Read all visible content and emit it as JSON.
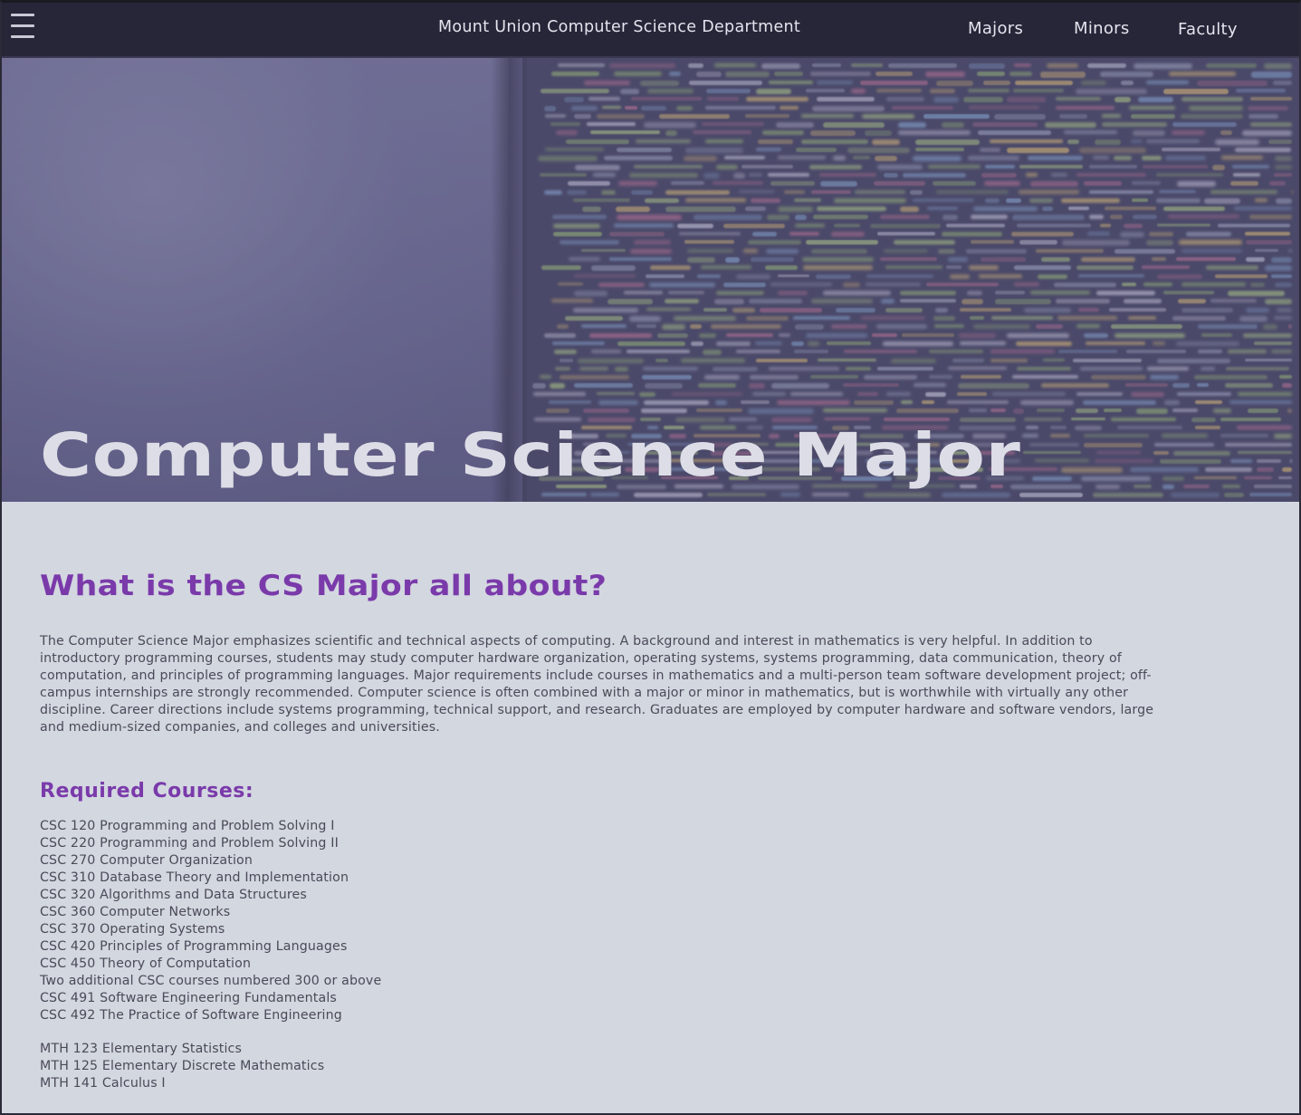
{
  "nav": {
    "menu_icon": "hamburger-menu-icon",
    "site_title": "Mount Union Computer Science Department",
    "links": [
      {
        "label": "Majors"
      },
      {
        "label": "Minors"
      },
      {
        "label": "Faculty"
      }
    ]
  },
  "hero": {
    "title": "Computer Science Major",
    "background": "blurred-code-on-monitor-image"
  },
  "about": {
    "heading": "What is the CS Major all about?",
    "description": "The Computer Science Major emphasizes scientific and technical aspects of computing. A background and interest in mathematics is very helpful.  In addition to introductory programming courses, students may study computer hardware organization, operating systems, systems programming, data communication, theory of computation, and principles of programming languages.  Major requirements include courses in mathematics and a multi-person team software de­velopment project; off-campus internships are strongly recommended.  Computer science is often combined with a major or minor in mathematics, but is worthwhile with virtually any other discipline.  Career directions include systems programming, technical support, and research.  Graduates are employed by computer hardware and software vendors, large and medium-sized companies, and colleges and universities."
  },
  "requirements": {
    "heading": "Required Courses:",
    "cs_courses": [
      "CSC 120 Programming and Problem Solving I",
      "CSC 220 Programming and Problem Solving II",
      "CSC 270 Computer Organization",
      "CSC 310 Database Theory and Implementation",
      "CSC 320 Algorithms and Data Structures",
      "CSC 360 Computer Networks",
      "CSC 370 Operating Systems",
      "CSC 420 Principles of Programming Languages",
      "CSC 450 Theory of Computation",
      "Two additional CSC courses numbered 300 or above",
      "CSC 491 Software Engineering Fundamentals",
      "CSC 492 The Practice of Software Engineering"
    ],
    "math_courses": [
      "MTH 123 Elementary Statistics",
      "MTH 125 Elementary Discrete Mathematics",
      "MTH 141 Calculus I"
    ]
  },
  "colors": {
    "nav_bg": "#272538",
    "page_bg": "#d3d7e0",
    "accent_purple": "#7a3aaa",
    "body_text": "#4a4a58",
    "hero_title": "#dcdde6"
  }
}
